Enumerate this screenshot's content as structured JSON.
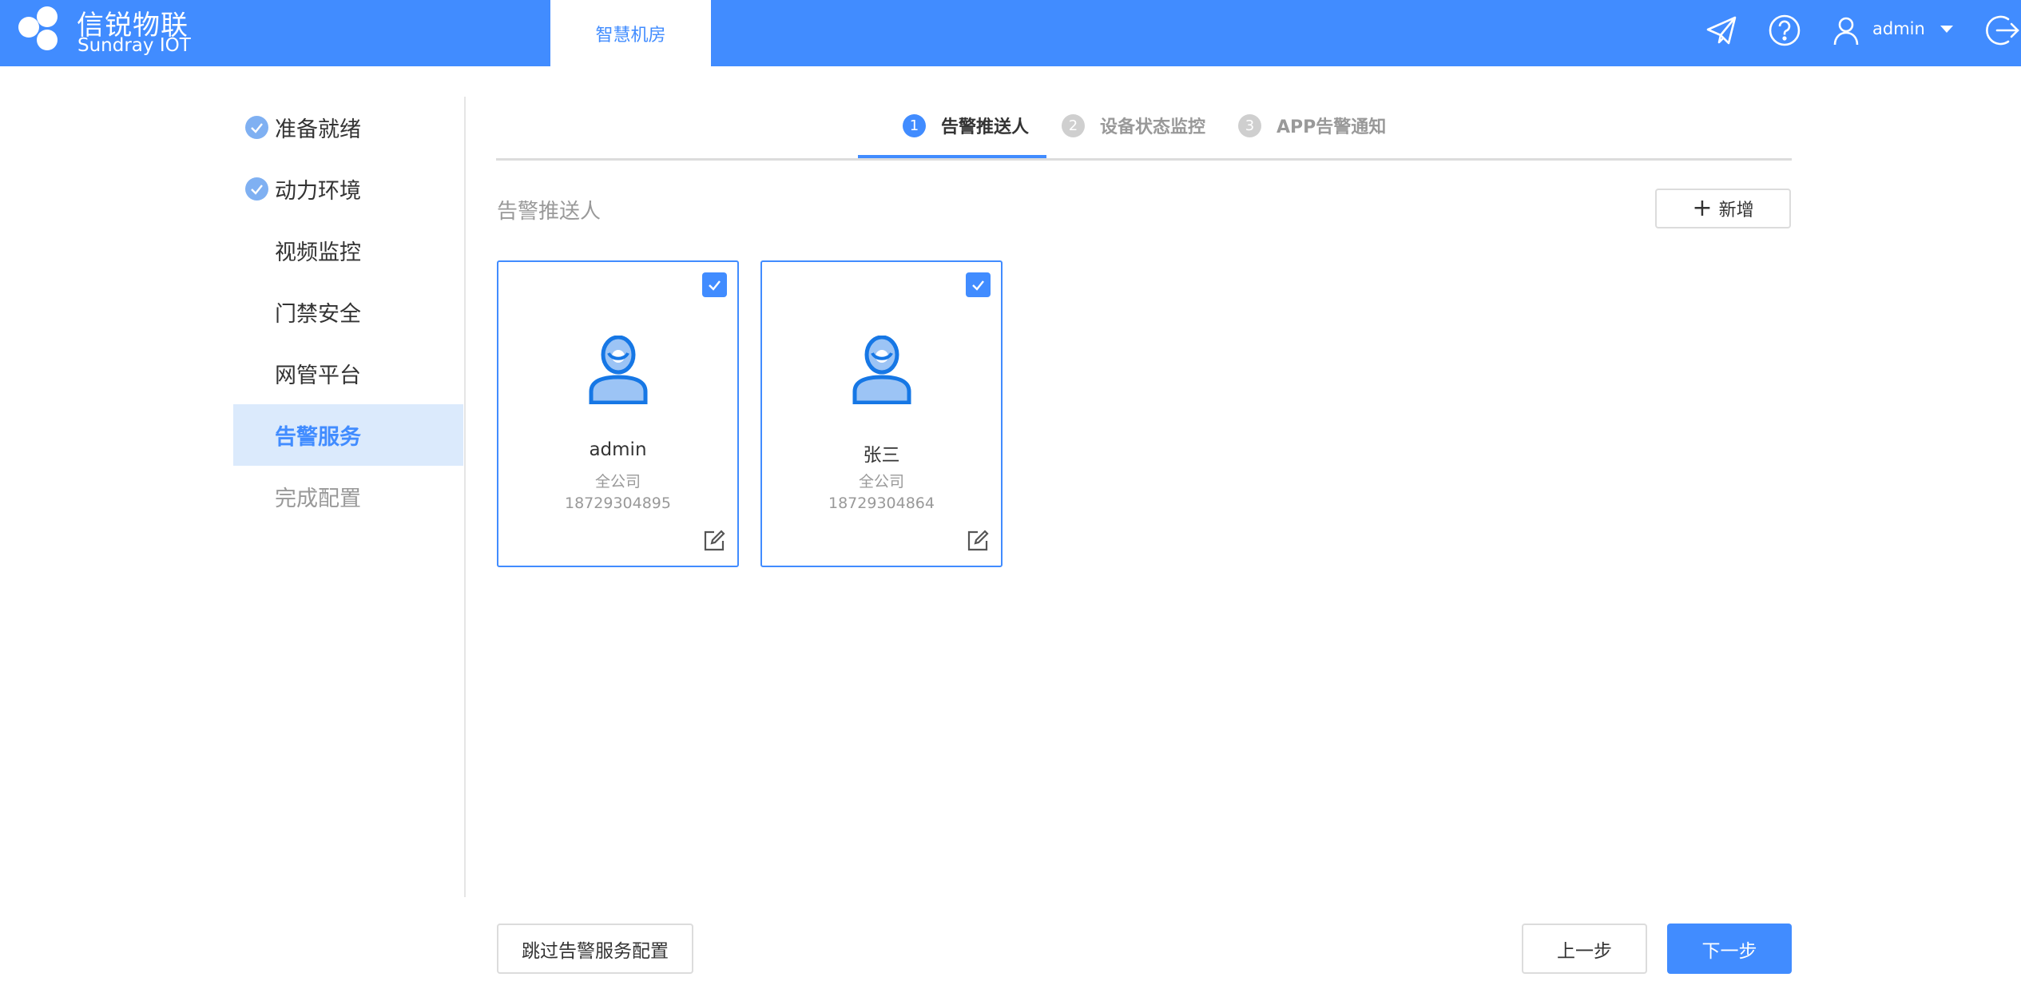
{
  "brand": {
    "name_cn": "信锐物联",
    "name_en": "Sundray IOT"
  },
  "header": {
    "nav_tab": "智慧机房",
    "user": "admin",
    "icons": [
      "send-icon",
      "help-icon",
      "user-icon",
      "logout-icon"
    ]
  },
  "sidebar": {
    "items": [
      {
        "label": "准备就绪",
        "state": "done"
      },
      {
        "label": "动力环境",
        "state": "done"
      },
      {
        "label": "视频监控",
        "state": "normal"
      },
      {
        "label": "门禁安全",
        "state": "normal"
      },
      {
        "label": "网管平台",
        "state": "normal"
      },
      {
        "label": "告警服务",
        "state": "active"
      },
      {
        "label": "完成配置",
        "state": "disabled"
      }
    ]
  },
  "steps": [
    {
      "num": "1",
      "label": "告警推送人"
    },
    {
      "num": "2",
      "label": "设备状态监控"
    },
    {
      "num": "3",
      "label": "APP告警通知"
    }
  ],
  "section": {
    "title": "告警推送人",
    "add_label": "新增"
  },
  "contacts": [
    {
      "name": "admin",
      "dept": "全公司",
      "phone": "18729304895",
      "checked": true
    },
    {
      "name": "张三",
      "dept": "全公司",
      "phone": "18729304864",
      "checked": true
    }
  ],
  "footer": {
    "skip": "跳过告警服务配置",
    "prev": "上一步",
    "next": "下一步"
  },
  "colors": {
    "accent": "#418cff",
    "active_bg": "#dbeafc",
    "avatar_light": "#9cc4f5",
    "done_check": "#7fb0f2"
  }
}
